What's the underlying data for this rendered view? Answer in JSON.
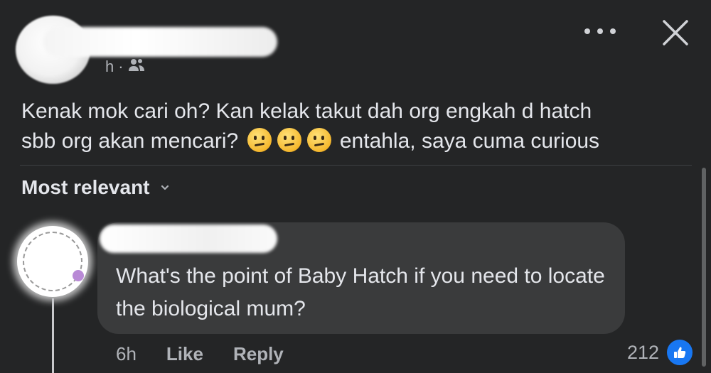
{
  "post": {
    "meta_time_fragment": "h",
    "meta_separator": "·",
    "audience_icon": "friends-icon",
    "text_line1": "Kenak mok cari oh? Kan kelak takut dah org engkah d hatch",
    "text_line2_before": "sbb org akan mencari?",
    "text_line2_after": "entahla, saya cuma curious",
    "emoji_name": "thinking-face-emoji"
  },
  "header": {
    "more_icon": "more-horizontal-icon",
    "close_icon": "close-icon"
  },
  "comments_sort": {
    "label": "Most relevant",
    "chevron_icon": "chevron-down-icon"
  },
  "comment": {
    "text": "What's the point of Baby Hatch if you need to locate the biological mum?",
    "time": "6h",
    "like_label": "Like",
    "reply_label": "Reply",
    "reaction_count": "212",
    "reaction_icon": "like-reaction-icon"
  },
  "colors": {
    "background": "#242526",
    "bubble": "#3a3b3c",
    "text_primary": "#e4e6eb",
    "text_secondary": "#b0b3b8",
    "like_blue": "#1877f2"
  }
}
